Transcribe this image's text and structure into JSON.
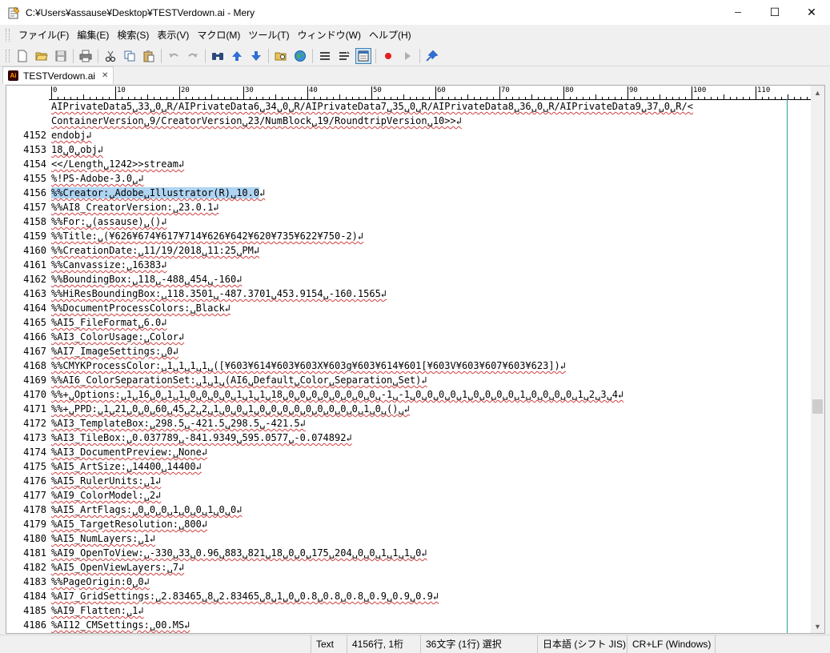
{
  "window": {
    "title": "C:¥Users¥assause¥Desktop¥TESTVerdown.ai - Mery",
    "minimize": "─",
    "maximize": "☐",
    "close": "✕"
  },
  "menu": [
    "ファイル(F)",
    "編集(E)",
    "検索(S)",
    "表示(V)",
    "マクロ(M)",
    "ツール(T)",
    "ウィンドウ(W)",
    "ヘルプ(H)"
  ],
  "toolbar": {
    "buttons": [
      "new-file",
      "open-file",
      "save",
      "print",
      "cut",
      "copy",
      "paste",
      "undo",
      "redo",
      "find",
      "find-prev",
      "find-next",
      "open-folder",
      "web-browser",
      "list",
      "list-detail",
      "view-mode",
      "record-macro",
      "play-macro",
      "pin"
    ]
  },
  "tab": {
    "label": "TESTVerdown.ai",
    "close": "✕",
    "icon": "Ai"
  },
  "ruler": {
    "labels": [
      "0",
      "10",
      "20",
      "30",
      "40",
      "50",
      "60",
      "70",
      "80",
      "90",
      "100",
      "110"
    ]
  },
  "lines": [
    {
      "num": "",
      "text": "AIPrivateData5␣33␣0␣R/AIPrivateData6␣34␣0␣R/AIPrivateData7␣35␣0␣R/AIPrivateData8␣36␣0␣R/AIPrivateData9␣37␣0␣R/<"
    },
    {
      "num": "",
      "text": "ContainerVersion␣9/CreatorVersion␣23/NumBlock␣19/RoundtripVersion␣10>>↲"
    },
    {
      "num": "4152",
      "text": "endobj↲"
    },
    {
      "num": "4153",
      "text": "18␣0␣obj↲"
    },
    {
      "num": "4154",
      "text": "<</Length␣1242>>stream↲"
    },
    {
      "num": "4155",
      "text": "%!PS-Adobe-3.0␣↲"
    },
    {
      "num": "4156",
      "text": "%%Creator:␣Adobe␣Illustrator(R)␣10.0",
      "tail": "↲",
      "selected": true
    },
    {
      "num": "4157",
      "text": "%%AI8_CreatorVersion:␣23.0.1↲"
    },
    {
      "num": "4158",
      "text": "%%For:␣(assause)␣()↲"
    },
    {
      "num": "4159",
      "text": "%%Title:␣(¥626¥674¥617¥714¥626¥642¥620¥735¥622¥750-2)↲"
    },
    {
      "num": "4160",
      "text": "%%CreationDate:␣11/19/2018␣11:25␣PM↲"
    },
    {
      "num": "4161",
      "text": "%%Canvassize:␣16383↲"
    },
    {
      "num": "4162",
      "text": "%%BoundingBox:␣118␣-488␣454␣-160↲"
    },
    {
      "num": "4163",
      "text": "%%HiResBoundingBox:␣118.3501␣-487.3701␣453.9154␣-160.1565↲"
    },
    {
      "num": "4164",
      "text": "%%DocumentProcessColors:␣Black↲"
    },
    {
      "num": "4165",
      "text": "%AI5_FileFormat␣6.0↲"
    },
    {
      "num": "4166",
      "text": "%AI3_ColorUsage:␣Color↲"
    },
    {
      "num": "4167",
      "text": "%AI7_ImageSettings:␣0↲"
    },
    {
      "num": "4168",
      "text": "%%CMYKProcessColor:␣1␣1␣1␣1␣([¥603¥614¥603¥603X¥603g¥603¥614¥601[¥603V¥603¥607¥603¥623])↲"
    },
    {
      "num": "4169",
      "text": "%%AI6_ColorSeparationSet:␣1␣1␣(AI6␣Default␣Color␣Separation␣Set)↲"
    },
    {
      "num": "4170",
      "text": "%%+␣Options:␣1␣16␣0␣1␣1␣0␣0␣0␣0␣1␣1␣1␣18␣0␣0␣0␣0␣0␣0␣0␣0␣-1␣-1␣0␣0␣0␣0␣1␣0␣0␣0␣0␣1␣0␣0␣0␣0␣1␣2␣3␣4↲"
    },
    {
      "num": "4171",
      "text": "%%+␣PPD:␣1␣21␣0␣0␣60␣45␣2␣2␣1␣0␣0␣1␣0␣0␣0␣0␣0␣0␣0␣0␣0␣1␣0␣()␣↲"
    },
    {
      "num": "4172",
      "text": "%AI3_TemplateBox:␣298.5␣-421.5␣298.5␣-421.5↲"
    },
    {
      "num": "4173",
      "text": "%AI3_TileBox:␣0.037789␣-841.9349␣595.0577␣-0.074892↲"
    },
    {
      "num": "4174",
      "text": "%AI3_DocumentPreview:␣None↲"
    },
    {
      "num": "4175",
      "text": "%AI5_ArtSize:␣14400␣14400↲"
    },
    {
      "num": "4176",
      "text": "%AI5_RulerUnits:␣1↲"
    },
    {
      "num": "4177",
      "text": "%AI9_ColorModel:␣2↲"
    },
    {
      "num": "4178",
      "text": "%AI5_ArtFlags:␣0␣0␣0␣1␣0␣0␣1␣0␣0↲"
    },
    {
      "num": "4179",
      "text": "%AI5_TargetResolution:␣800↲"
    },
    {
      "num": "4180",
      "text": "%AI5_NumLayers:␣1↲"
    },
    {
      "num": "4181",
      "text": "%AI9_OpenToView:␣-330␣33␣0.96␣883␣821␣18␣0␣0␣175␣204␣0␣0␣1␣1␣1␣0↲"
    },
    {
      "num": "4182",
      "text": "%AI5_OpenViewLayers:␣7↲"
    },
    {
      "num": "4183",
      "text": "%%PageOrigin:0␣0↲"
    },
    {
      "num": "4184",
      "text": "%AI7_GridSettings:␣2.83465␣8␣2.83465␣8␣1␣0␣0.8␣0.8␣0.8␣0.9␣0.9␣0.9↲"
    },
    {
      "num": "4185",
      "text": "%AI9_Flatten:␣1↲"
    },
    {
      "num": "4186",
      "text": "%AI12_CMSettings:␣00.MS↲"
    }
  ],
  "status": {
    "mode": "Text",
    "position": "4156行, 1桁",
    "selection": "36文字 (1行) 選択",
    "encoding": "日本語 (シフト JIS)",
    "line_ending": "CR+LF (Windows)"
  },
  "colors": {
    "selection": "#aed4f2",
    "wrap_marker": "#2aa0a0"
  }
}
